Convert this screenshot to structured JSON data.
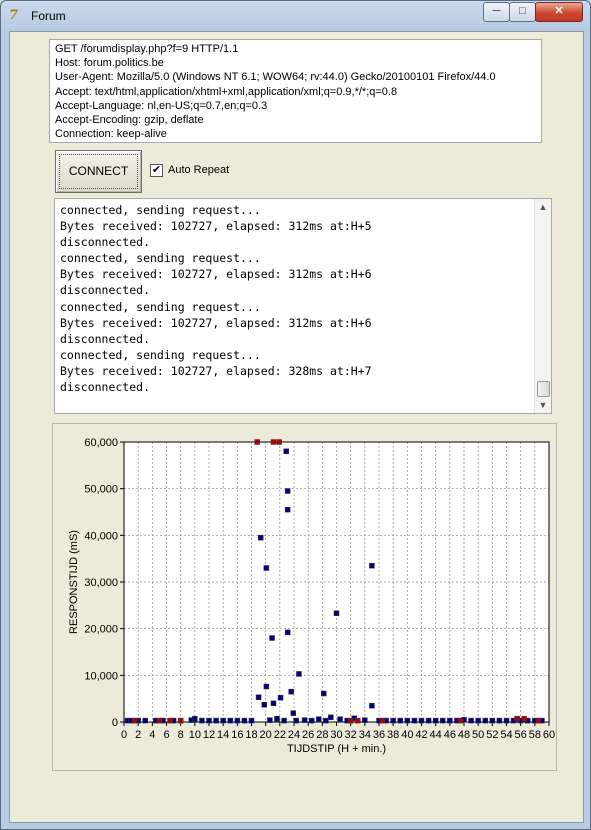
{
  "window": {
    "title": "Forum",
    "icon": "app-icon",
    "icon_glyph": "7",
    "min_glyph": "─",
    "max_glyph": "□",
    "close_glyph": "✕"
  },
  "request": {
    "lines": [
      "GET /forumdisplay.php?f=9 HTTP/1.1",
      "Host: forum.politics.be",
      "User-Agent: Mozilla/5.0 (Windows NT 6.1; WOW64; rv:44.0) Gecko/20100101 Firefox/44.0",
      "Accept: text/html,application/xhtml+xml,application/xml;q=0.9,*/*;q=0.8",
      "Accept-Language: nl,en-US;q=0.7,en;q=0.3",
      "Accept-Encoding: gzip, deflate",
      "Connection: keep-alive"
    ]
  },
  "controls": {
    "connect_label": "CONNECT",
    "auto_repeat_label": "Auto Repeat",
    "auto_repeat_checked": true,
    "check_glyph": "✔"
  },
  "log": {
    "lines": [
      "connected, sending request...",
      "Bytes received: 102727, elapsed: 312ms at:H+5",
      "disconnected.",
      "connected, sending request...",
      "Bytes received: 102727, elapsed: 312ms at:H+6",
      "disconnected.",
      "connected, sending request...",
      "Bytes received: 102727, elapsed: 312ms at:H+6",
      "disconnected.",
      "connected, sending request...",
      "Bytes received: 102727, elapsed: 328ms at:H+7",
      "disconnected."
    ],
    "scroll_up_glyph": "▲",
    "scroll_down_glyph": "▼"
  },
  "chart_data": {
    "type": "scatter",
    "title": "",
    "xlabel": "TIJDSTIP (H + min.)",
    "ylabel": "RESPONSTIJD (mS)",
    "xlim": [
      0,
      60
    ],
    "ylim": [
      0,
      60000
    ],
    "xticks": [
      0,
      2,
      4,
      6,
      8,
      10,
      12,
      14,
      16,
      18,
      20,
      22,
      24,
      26,
      28,
      30,
      32,
      34,
      36,
      38,
      40,
      42,
      44,
      46,
      48,
      50,
      52,
      54,
      56,
      58,
      60
    ],
    "xtick_labels": [
      "0",
      "2",
      "4",
      "6",
      "8",
      "10",
      "12",
      "14",
      "16",
      "18",
      "20",
      "22",
      "24",
      "26",
      "28",
      "30",
      "32",
      "34",
      "36",
      "38",
      "40",
      "42",
      "44",
      "46",
      "48",
      "50",
      "52",
      "54",
      "56",
      "58",
      "60"
    ],
    "yticks": [
      0,
      10000,
      20000,
      30000,
      40000,
      50000,
      60000
    ],
    "ytick_labels": [
      "0",
      "10,000",
      "20,000",
      "30,000",
      "40,000",
      "50,000",
      "60,000"
    ],
    "grid": true,
    "colors": {
      "ok": "#000080",
      "error": "#b00000"
    },
    "series": [
      {
        "status": "ok",
        "points": [
          [
            0.5,
            300
          ],
          [
            1,
            300
          ],
          [
            2,
            300
          ],
          [
            3,
            300
          ],
          [
            4.5,
            300
          ],
          [
            5.5,
            300
          ],
          [
            7,
            300
          ],
          [
            9.5,
            400
          ],
          [
            10,
            700
          ],
          [
            11,
            300
          ],
          [
            12,
            300
          ],
          [
            13,
            300
          ],
          [
            14,
            300
          ],
          [
            15,
            300
          ],
          [
            16,
            300
          ],
          [
            17,
            300
          ],
          [
            18,
            300
          ],
          [
            19,
            5300
          ],
          [
            19.3,
            39500
          ],
          [
            19.8,
            3700
          ],
          [
            20.1,
            33000
          ],
          [
            20.1,
            7600
          ],
          [
            20.6,
            400
          ],
          [
            20.9,
            18000
          ],
          [
            21.1,
            4000
          ],
          [
            21.6,
            700
          ],
          [
            22.1,
            5200
          ],
          [
            22.6,
            300
          ],
          [
            22.9,
            58000
          ],
          [
            23.1,
            49500
          ],
          [
            23.1,
            45500
          ],
          [
            23.1,
            19200
          ],
          [
            23.6,
            6500
          ],
          [
            23.9,
            1900
          ],
          [
            24.3,
            300
          ],
          [
            24.7,
            10300
          ],
          [
            25.5,
            400
          ],
          [
            26.5,
            300
          ],
          [
            27.5,
            600
          ],
          [
            28.2,
            6100
          ],
          [
            28.5,
            300
          ],
          [
            29.2,
            1000
          ],
          [
            30,
            23300
          ],
          [
            30.5,
            600
          ],
          [
            31.5,
            300
          ],
          [
            32.5,
            800
          ],
          [
            34,
            400
          ],
          [
            35,
            33500
          ],
          [
            35,
            3500
          ],
          [
            36,
            300
          ],
          [
            37,
            300
          ],
          [
            38,
            300
          ],
          [
            39,
            300
          ],
          [
            40,
            300
          ],
          [
            41,
            300
          ],
          [
            42,
            300
          ],
          [
            43,
            300
          ],
          [
            44,
            300
          ],
          [
            45,
            300
          ],
          [
            46,
            300
          ],
          [
            47,
            300
          ],
          [
            48,
            500
          ],
          [
            49,
            300
          ],
          [
            50,
            300
          ],
          [
            51,
            300
          ],
          [
            52,
            300
          ],
          [
            53,
            300
          ],
          [
            54,
            300
          ],
          [
            55,
            300
          ],
          [
            56,
            300
          ],
          [
            57,
            300
          ],
          [
            58,
            300
          ],
          [
            59,
            300
          ]
        ]
      },
      {
        "status": "error",
        "points": [
          [
            1.5,
            300
          ],
          [
            5,
            300
          ],
          [
            6.5,
            300
          ],
          [
            8,
            300
          ],
          [
            18.8,
            60000
          ],
          [
            21.1,
            60000
          ],
          [
            21.9,
            60000
          ],
          [
            32,
            300
          ],
          [
            33,
            300
          ],
          [
            36.5,
            300
          ],
          [
            47.5,
            300
          ],
          [
            55.5,
            700
          ],
          [
            56.5,
            700
          ],
          [
            58.5,
            300
          ]
        ]
      }
    ]
  }
}
